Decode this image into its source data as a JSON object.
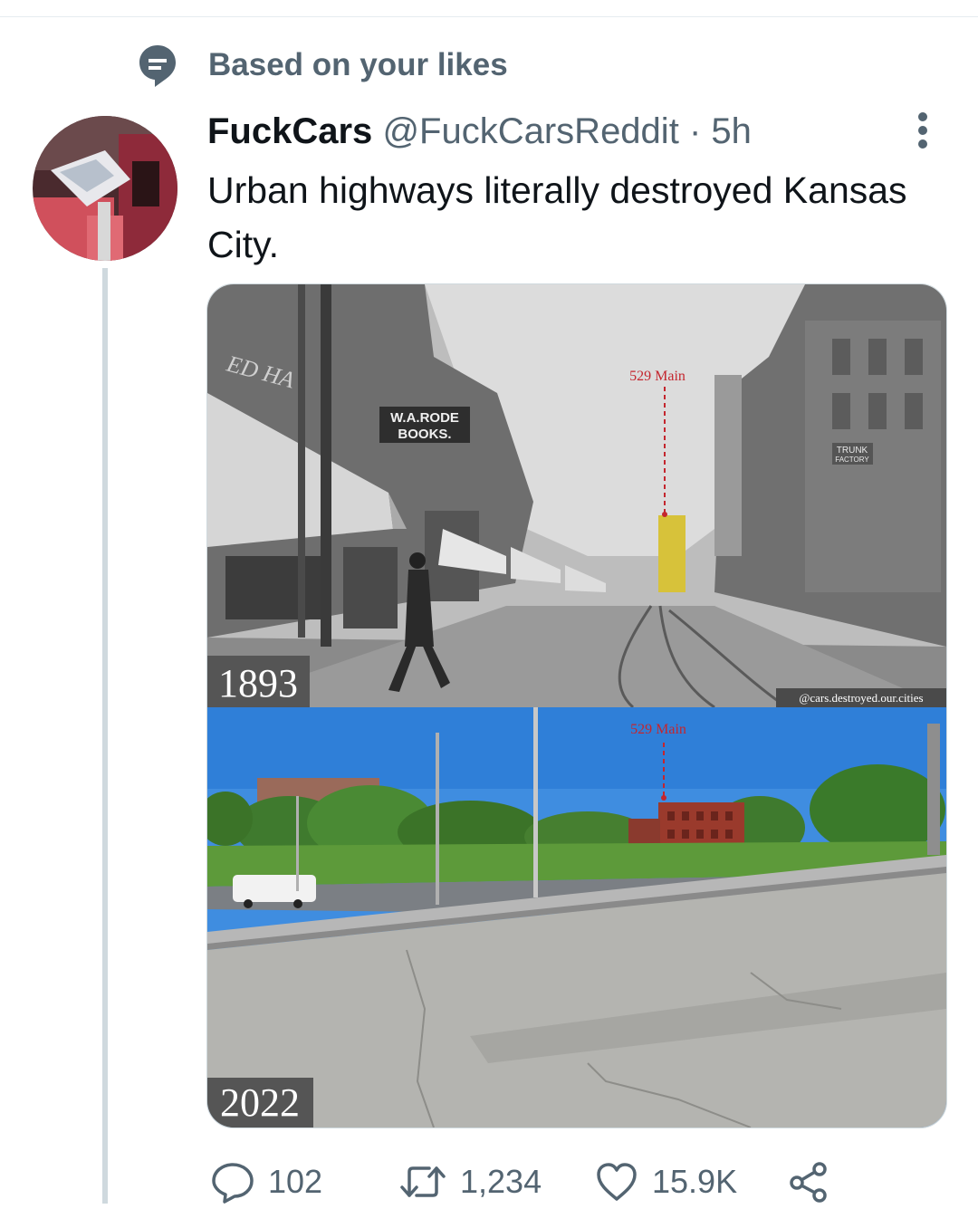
{
  "social_context": {
    "text": "Based on your likes",
    "icon": "speech-bubble-icon"
  },
  "tweet": {
    "display_name": "FuckCars",
    "handle": "@FuckCarsReddit",
    "separator": "·",
    "time": "5h",
    "text": "Urban highways literally destroyed Kansas City."
  },
  "media": {
    "top": {
      "year": "1893",
      "marker": "529 Main",
      "credit": "@cars.destroyed.our.cities",
      "signs": {
        "bookstore": "W.A.RODE",
        "bookstore_sub": "BOOKS.",
        "awning": "ED HA",
        "trunk": "TRUNK",
        "trunk_sub": "FACTORY"
      }
    },
    "bottom": {
      "year": "2022",
      "marker": "529 Main"
    }
  },
  "actions": {
    "reply": {
      "icon": "reply-icon",
      "count": "102"
    },
    "retweet": {
      "icon": "retweet-icon",
      "count": "1,234"
    },
    "like": {
      "icon": "heart-icon",
      "count": "15.9K"
    },
    "share": {
      "icon": "share-icon"
    }
  },
  "colors": {
    "marker": "#c4262e",
    "secondary_text": "#536471",
    "highlight": "#d7c23a"
  }
}
